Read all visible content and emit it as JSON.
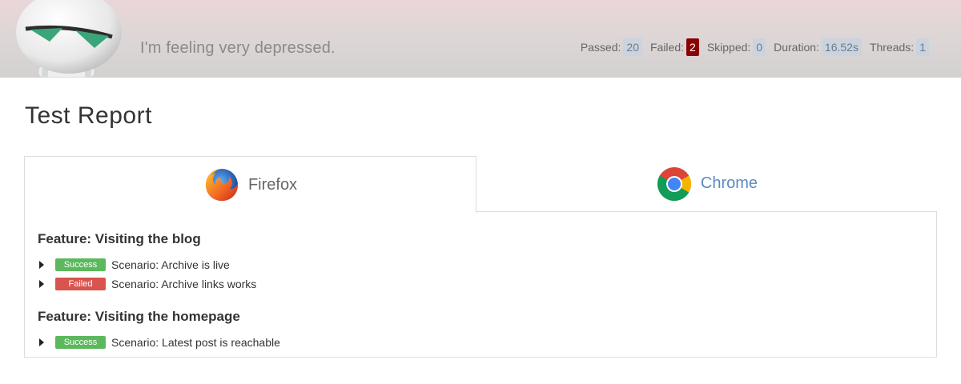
{
  "header": {
    "tagline": "I'm feeling very depressed.",
    "stats": [
      {
        "label": "Passed:",
        "value": "20"
      },
      {
        "label": "Failed:",
        "value": "2"
      },
      {
        "label": "Skipped:",
        "value": "0"
      },
      {
        "label": "Duration:",
        "value": "16.52s"
      },
      {
        "label": "Threads:",
        "value": "1"
      }
    ]
  },
  "page": {
    "title": "Test Report"
  },
  "tabs": [
    {
      "label": "Firefox",
      "icon": "firefox-icon",
      "active": true
    },
    {
      "label": "Chrome",
      "icon": "chrome-icon",
      "active": false
    }
  ],
  "features": [
    {
      "title": "Feature: Visiting the blog",
      "scenarios": [
        {
          "status": "Success",
          "name": "Scenario: Archive is live"
        },
        {
          "status": "Failed",
          "name": "Scenario: Archive links works"
        }
      ]
    },
    {
      "title": "Feature: Visiting the homepage",
      "scenarios": [
        {
          "status": "Success",
          "name": "Scenario: Latest post is reachable"
        }
      ]
    }
  ],
  "colors": {
    "success": "#5cb85c",
    "failed": "#d9534f",
    "failed_count": "#8b0000",
    "link": "#5b8ac0"
  }
}
